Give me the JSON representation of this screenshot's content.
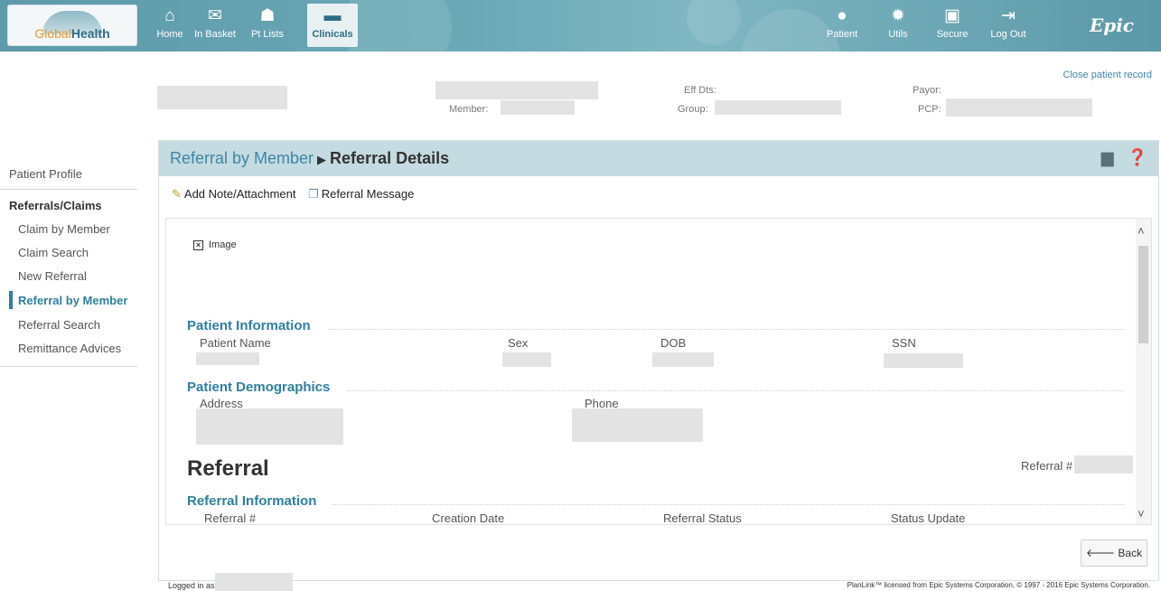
{
  "brand": {
    "logo_part1": "Global",
    "logo_part2": "Health",
    "epic": "Epic"
  },
  "nav_left": [
    {
      "label": "Home",
      "icon": "home-icon",
      "glyph": "⌂"
    },
    {
      "label": "In Basket",
      "icon": "envelope-icon",
      "glyph": "✉"
    },
    {
      "label": "Pt Lists",
      "icon": "people-icon",
      "glyph": "👥"
    },
    {
      "label": "Clinicals",
      "icon": "folder-icon",
      "glyph": "▬"
    }
  ],
  "nav_right": [
    {
      "label": "Patient",
      "icon": "person-icon",
      "glyph": "●"
    },
    {
      "label": "Utils",
      "icon": "gear-icon",
      "glyph": "✹"
    },
    {
      "label": "Secure",
      "icon": "lock-icon",
      "glyph": "🔒"
    },
    {
      "label": "Log Out",
      "icon": "logout-icon",
      "glyph": "⇥"
    }
  ],
  "header": {
    "close_link": "Close patient record",
    "member_label": "Member:",
    "eff_dts_label": "Eff Dts:",
    "group_label": "Group:",
    "payor_label": "Payor:",
    "pcp_label": "PCP:"
  },
  "sidebar": {
    "profile": "Patient Profile",
    "section": "Referrals/Claims",
    "items": [
      "Claim by Member",
      "Claim Search",
      "New Referral",
      "Referral by Member",
      "Referral Search",
      "Remittance Advices"
    ],
    "active_index": 3
  },
  "panel": {
    "crumb_link": "Referral by Member",
    "crumb_current": "Referral Details",
    "toolbar": {
      "add_note": "Add Note/Attachment",
      "referral_message": "Referral Message"
    },
    "image_placeholder": "Image",
    "patient_info": {
      "title": "Patient Information",
      "patient_name": "Patient Name",
      "sex": "Sex",
      "dob": "DOB",
      "ssn": "SSN"
    },
    "demographics": {
      "title": "Patient Demographics",
      "address": "Address",
      "phone": "Phone"
    },
    "referral_title": "Referral",
    "referral_num_label": "Referral #",
    "referral_info": {
      "title": "Referral Information",
      "referral_num": "Referral #",
      "creation_date": "Creation Date",
      "referral_status": "Referral Status",
      "status_update": "Status Update"
    },
    "back_button": "Back"
  },
  "footer": {
    "logged_in": "Logged in as:",
    "license": "PlanLink™ licensed from Epic Systems Corporation, © 1997 - 2016 Epic Systems Corporation."
  }
}
